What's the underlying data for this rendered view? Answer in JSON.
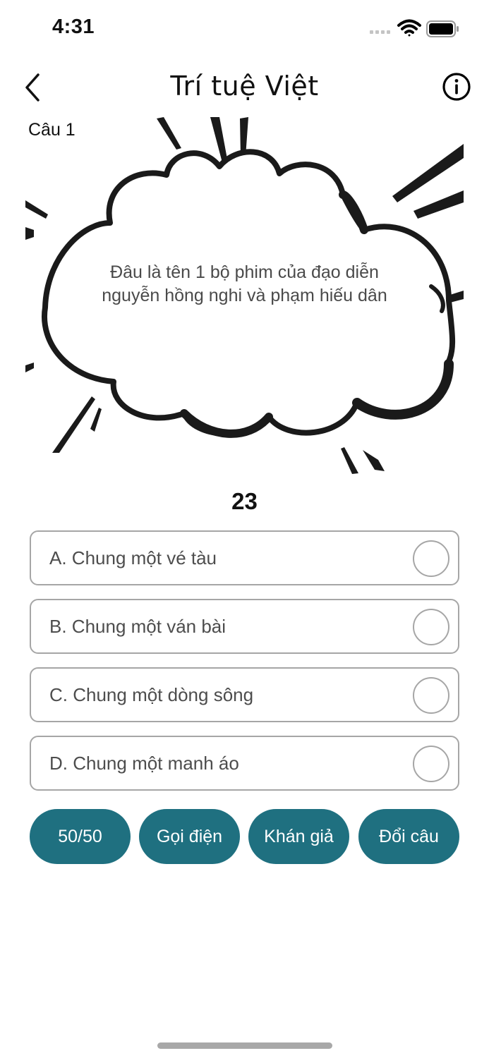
{
  "status_bar": {
    "time": "4:31"
  },
  "nav": {
    "title": "Trí tuệ Việt"
  },
  "question": {
    "number_label": "Câu 1",
    "text": "Đâu là tên 1 bộ phim của đạo diễn nguyễn hồng nghi và phạm hiếu dân"
  },
  "timer": "23",
  "answers": [
    {
      "label": "A. Chung một vé tàu"
    },
    {
      "label": "B. Chung một ván bài"
    },
    {
      "label": "C. Chung một dòng sông"
    },
    {
      "label": "D. Chung một manh áo"
    }
  ],
  "lifelines": [
    {
      "label": "50/50"
    },
    {
      "label": "Gọi điện"
    },
    {
      "label": "Khán giả"
    },
    {
      "label": "Đổi câu"
    }
  ],
  "colors": {
    "accent": "#1f7080",
    "border": "#a6a6a6",
    "text_muted": "#4d4d4d"
  },
  "icons": [
    "signal-icon",
    "wifi-icon",
    "battery-icon",
    "back-chevron-icon",
    "info-icon"
  ]
}
